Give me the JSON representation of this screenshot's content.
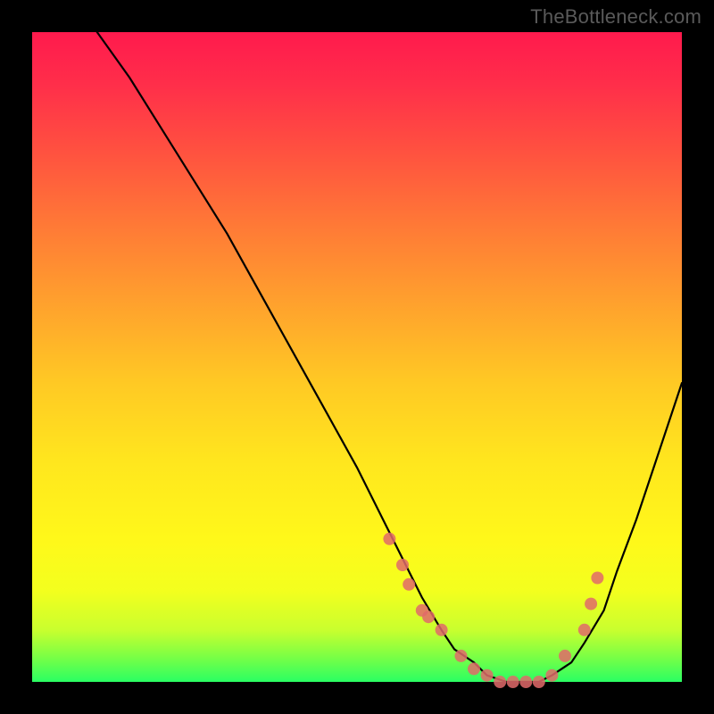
{
  "watermark": {
    "text": "TheBottleneck.com"
  },
  "colors": {
    "background": "#000000",
    "curve": "#000000",
    "points": "#e06a6a",
    "gradient_top": "#ff1a4d",
    "gradient_bottom": "#2aff63"
  },
  "chart_data": {
    "type": "line",
    "title": "",
    "xlabel": "",
    "ylabel": "",
    "xlim": [
      0,
      100
    ],
    "ylim": [
      0,
      100
    ],
    "grid": false,
    "legend": false,
    "series": [
      {
        "name": "bottleneck-curve",
        "x": [
          10,
          15,
          20,
          25,
          30,
          35,
          40,
          45,
          50,
          55,
          58,
          60,
          63,
          65,
          68,
          70,
          73,
          75,
          78,
          80,
          83,
          85,
          88,
          90,
          93,
          96,
          100
        ],
        "y": [
          100,
          93,
          85,
          77,
          69,
          60,
          51,
          42,
          33,
          23,
          17,
          13,
          8,
          5,
          3,
          1,
          0,
          0,
          0,
          1,
          3,
          6,
          11,
          17,
          25,
          34,
          46
        ]
      }
    ],
    "scatter_points": {
      "name": "highlight-points",
      "x": [
        55,
        57,
        58,
        60,
        61,
        63,
        66,
        68,
        70,
        72,
        74,
        76,
        78,
        80,
        82,
        85,
        86,
        87
      ],
      "y": [
        22,
        18,
        15,
        11,
        10,
        8,
        4,
        2,
        1,
        0,
        0,
        0,
        0,
        1,
        4,
        8,
        12,
        16
      ]
    }
  }
}
